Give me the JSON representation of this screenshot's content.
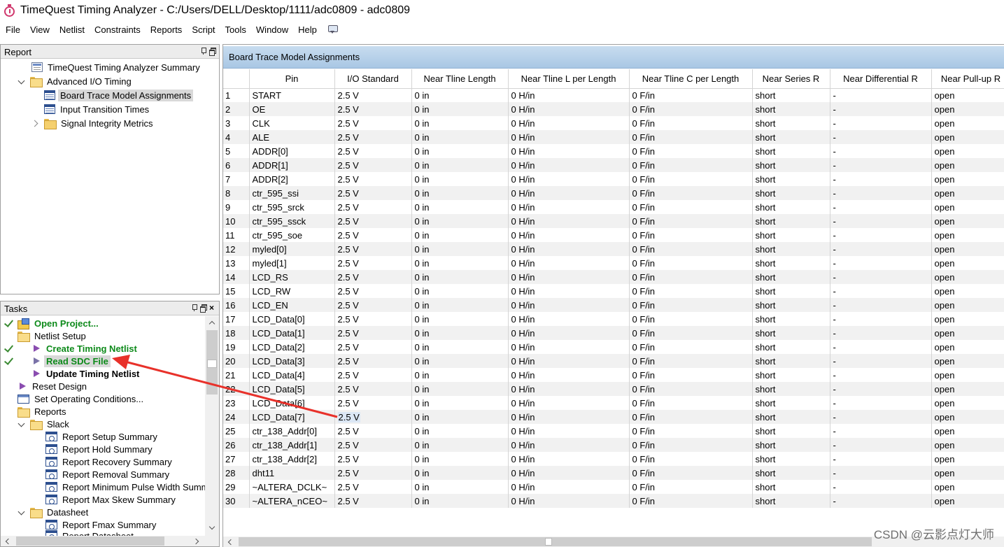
{
  "window": {
    "title": "TimeQuest Timing Analyzer - C:/Users/DELL/Desktop/1111/adc0809 - adc0809"
  },
  "menu": [
    "File",
    "View",
    "Netlist",
    "Constraints",
    "Reports",
    "Script",
    "Tools",
    "Window",
    "Help"
  ],
  "report_panel": {
    "title": "Report",
    "items": [
      {
        "label": "TimeQuest Timing Analyzer Summary",
        "icon": "summary-icon"
      },
      {
        "label": "Advanced I/O Timing",
        "icon": "folder-open-icon"
      },
      {
        "label": "Board Trace Model Assignments",
        "icon": "table-icon"
      },
      {
        "label": "Input Transition Times",
        "icon": "table-icon"
      },
      {
        "label": "Signal Integrity Metrics",
        "icon": "folder-icon"
      }
    ]
  },
  "tasks_panel": {
    "title": "Tasks",
    "items": [
      {
        "label": "Open Project..."
      },
      {
        "label": "Netlist Setup"
      },
      {
        "label": "Create Timing Netlist"
      },
      {
        "label": "Read SDC File"
      },
      {
        "label": "Update Timing Netlist"
      },
      {
        "label": "Reset Design"
      },
      {
        "label": "Set Operating Conditions..."
      },
      {
        "label": "Reports"
      },
      {
        "label": "Slack"
      },
      {
        "label": "Report Setup Summary"
      },
      {
        "label": "Report Hold Summary"
      },
      {
        "label": "Report Recovery Summary"
      },
      {
        "label": "Report Removal Summary"
      },
      {
        "label": "Report Minimum Pulse Width Summ"
      },
      {
        "label": "Report Max Skew Summary"
      },
      {
        "label": "Datasheet"
      },
      {
        "label": "Report Fmax Summary"
      },
      {
        "label": "Report Datasheet"
      }
    ]
  },
  "main": {
    "title": "Board Trace Model Assignments",
    "columns": [
      "",
      "Pin",
      "I/O Standard",
      "Near Tline Length",
      "Near Tline L per Length",
      "Near Tline C per Length",
      "Near Series R",
      "Near Differential R",
      "Near Pull-up R"
    ],
    "rows": [
      [
        "1",
        "START",
        "2.5 V",
        "0 in",
        "0 H/in",
        "0 F/in",
        "short",
        "-",
        "open"
      ],
      [
        "2",
        "OE",
        "2.5 V",
        "0 in",
        "0 H/in",
        "0 F/in",
        "short",
        "-",
        "open"
      ],
      [
        "3",
        "CLK",
        "2.5 V",
        "0 in",
        "0 H/in",
        "0 F/in",
        "short",
        "-",
        "open"
      ],
      [
        "4",
        "ALE",
        "2.5 V",
        "0 in",
        "0 H/in",
        "0 F/in",
        "short",
        "-",
        "open"
      ],
      [
        "5",
        "ADDR[0]",
        "2.5 V",
        "0 in",
        "0 H/in",
        "0 F/in",
        "short",
        "-",
        "open"
      ],
      [
        "6",
        "ADDR[1]",
        "2.5 V",
        "0 in",
        "0 H/in",
        "0 F/in",
        "short",
        "-",
        "open"
      ],
      [
        "7",
        "ADDR[2]",
        "2.5 V",
        "0 in",
        "0 H/in",
        "0 F/in",
        "short",
        "-",
        "open"
      ],
      [
        "8",
        "ctr_595_ssi",
        "2.5 V",
        "0 in",
        "0 H/in",
        "0 F/in",
        "short",
        "-",
        "open"
      ],
      [
        "9",
        "ctr_595_srck",
        "2.5 V",
        "0 in",
        "0 H/in",
        "0 F/in",
        "short",
        "-",
        "open"
      ],
      [
        "10",
        "ctr_595_ssck",
        "2.5 V",
        "0 in",
        "0 H/in",
        "0 F/in",
        "short",
        "-",
        "open"
      ],
      [
        "11",
        "ctr_595_soe",
        "2.5 V",
        "0 in",
        "0 H/in",
        "0 F/in",
        "short",
        "-",
        "open"
      ],
      [
        "12",
        "myled[0]",
        "2.5 V",
        "0 in",
        "0 H/in",
        "0 F/in",
        "short",
        "-",
        "open"
      ],
      [
        "13",
        "myled[1]",
        "2.5 V",
        "0 in",
        "0 H/in",
        "0 F/in",
        "short",
        "-",
        "open"
      ],
      [
        "14",
        "LCD_RS",
        "2.5 V",
        "0 in",
        "0 H/in",
        "0 F/in",
        "short",
        "-",
        "open"
      ],
      [
        "15",
        "LCD_RW",
        "2.5 V",
        "0 in",
        "0 H/in",
        "0 F/in",
        "short",
        "-",
        "open"
      ],
      [
        "16",
        "LCD_EN",
        "2.5 V",
        "0 in",
        "0 H/in",
        "0 F/in",
        "short",
        "-",
        "open"
      ],
      [
        "17",
        "LCD_Data[0]",
        "2.5 V",
        "0 in",
        "0 H/in",
        "0 F/in",
        "short",
        "-",
        "open"
      ],
      [
        "18",
        "LCD_Data[1]",
        "2.5 V",
        "0 in",
        "0 H/in",
        "0 F/in",
        "short",
        "-",
        "open"
      ],
      [
        "19",
        "LCD_Data[2]",
        "2.5 V",
        "0 in",
        "0 H/in",
        "0 F/in",
        "short",
        "-",
        "open"
      ],
      [
        "20",
        "LCD_Data[3]",
        "2.5 V",
        "0 in",
        "0 H/in",
        "0 F/in",
        "short",
        "-",
        "open"
      ],
      [
        "21",
        "LCD_Data[4]",
        "2.5 V",
        "0 in",
        "0 H/in",
        "0 F/in",
        "short",
        "-",
        "open"
      ],
      [
        "22",
        "LCD_Data[5]",
        "2.5 V",
        "0 in",
        "0 H/in",
        "0 F/in",
        "short",
        "-",
        "open"
      ],
      [
        "23",
        "LCD_Data[6]",
        "2.5 V",
        "0 in",
        "0 H/in",
        "0 F/in",
        "short",
        "-",
        "open"
      ],
      [
        "24",
        "LCD_Data[7]",
        "2.5 V",
        "0 in",
        "0 H/in",
        "0 F/in",
        "short",
        "-",
        "open"
      ],
      [
        "25",
        "ctr_138_Addr[0]",
        "2.5 V",
        "0 in",
        "0 H/in",
        "0 F/in",
        "short",
        "-",
        "open"
      ],
      [
        "26",
        "ctr_138_Addr[1]",
        "2.5 V",
        "0 in",
        "0 H/in",
        "0 F/in",
        "short",
        "-",
        "open"
      ],
      [
        "27",
        "ctr_138_Addr[2]",
        "2.5 V",
        "0 in",
        "0 H/in",
        "0 F/in",
        "short",
        "-",
        "open"
      ],
      [
        "28",
        "dht11",
        "2.5 V",
        "0 in",
        "0 H/in",
        "0 F/in",
        "short",
        "-",
        "open"
      ],
      [
        "29",
        "~ALTERA_DCLK~",
        "2.5 V",
        "0 in",
        "0 H/in",
        "0 F/in",
        "short",
        "-",
        "open"
      ],
      [
        "30",
        "~ALTERA_nCEO~",
        "2.5 V",
        "0 in",
        "0 H/in",
        "0 F/in",
        "short",
        "-",
        "open"
      ]
    ]
  },
  "watermark": "CSDN @云影点灯大师",
  "colors": {
    "task_done": "#0d8a1a",
    "check": "#3a8a32",
    "annotation_arrow": "#e8312a",
    "header_gradient_top": "#c8dcef",
    "header_gradient_bottom": "#a9c7e4"
  }
}
